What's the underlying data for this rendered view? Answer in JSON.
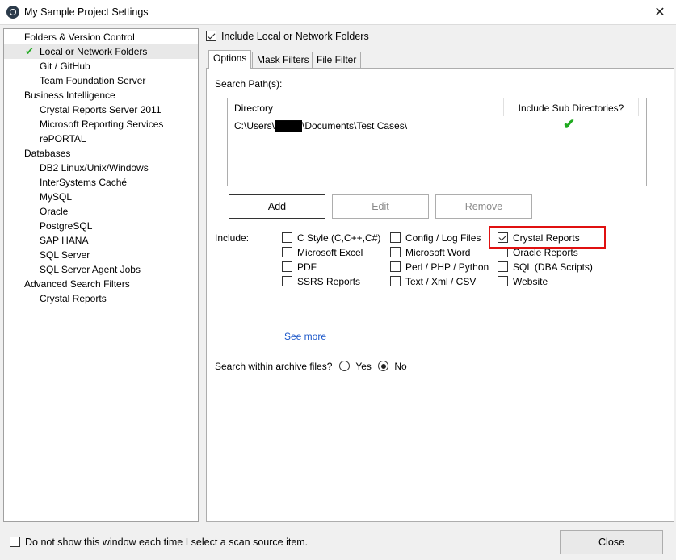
{
  "window": {
    "title": "My Sample Project Settings",
    "close_glyph": "✕"
  },
  "tree": [
    {
      "label": "Folders & Version Control",
      "indent": 0,
      "name": "tree-folders-version-control"
    },
    {
      "label": "Local or Network Folders",
      "indent": 1,
      "selected": true,
      "name": "tree-local-network-folders"
    },
    {
      "label": "Git / GitHub",
      "indent": 1,
      "name": "tree-git-github"
    },
    {
      "label": "Team Foundation Server",
      "indent": 1,
      "name": "tree-team-foundation-server"
    },
    {
      "label": "Business Intelligence",
      "indent": 0,
      "name": "tree-business-intelligence"
    },
    {
      "label": "Crystal Reports Server 2011",
      "indent": 1,
      "name": "tree-crystal-reports-server"
    },
    {
      "label": "Microsoft Reporting Services",
      "indent": 1,
      "name": "tree-ms-reporting-services"
    },
    {
      "label": "rePORTAL",
      "indent": 1,
      "name": "tree-reportal"
    },
    {
      "label": "Databases",
      "indent": 0,
      "name": "tree-databases"
    },
    {
      "label": "DB2 Linux/Unix/Windows",
      "indent": 1,
      "name": "tree-db2"
    },
    {
      "label": "InterSystems Caché",
      "indent": 1,
      "name": "tree-intersystems-cache"
    },
    {
      "label": "MySQL",
      "indent": 1,
      "name": "tree-mysql"
    },
    {
      "label": "Oracle",
      "indent": 1,
      "name": "tree-oracle"
    },
    {
      "label": "PostgreSQL",
      "indent": 1,
      "name": "tree-postgresql"
    },
    {
      "label": "SAP HANA",
      "indent": 1,
      "name": "tree-sap-hana"
    },
    {
      "label": "SQL Server",
      "indent": 1,
      "name": "tree-sql-server"
    },
    {
      "label": "SQL Server Agent Jobs",
      "indent": 1,
      "name": "tree-sql-server-agent-jobs"
    },
    {
      "label": "Advanced Search Filters",
      "indent": 0,
      "name": "tree-advanced-search-filters"
    },
    {
      "label": "Crystal Reports",
      "indent": 1,
      "name": "tree-crystal-reports"
    }
  ],
  "include_folders": {
    "label": "Include Local or Network Folders",
    "checked": true
  },
  "tabs": [
    "Options",
    "Mask Filters",
    "File Filter"
  ],
  "search_paths": {
    "label": "Search Path(s):",
    "col_directory": "Directory",
    "col_subdirs": "Include Sub Directories?",
    "rows": [
      {
        "path": "C:\\Users\\████\\Documents\\Test Cases\\",
        "subdirs": true
      }
    ],
    "check_glyph": "✔"
  },
  "buttons": {
    "add": "Add",
    "edit": "Edit",
    "remove": "Remove"
  },
  "include": {
    "label": "Include:",
    "items": [
      {
        "label": "C Style (C,C++,C#)",
        "checked": false,
        "name": "include-c-style"
      },
      {
        "label": "Microsoft Excel",
        "checked": false,
        "name": "include-ms-excel"
      },
      {
        "label": "PDF",
        "checked": false,
        "name": "include-pdf"
      },
      {
        "label": "SSRS Reports",
        "checked": false,
        "name": "include-ssrs"
      },
      {
        "label": "Config / Log Files",
        "checked": false,
        "name": "include-config-log"
      },
      {
        "label": "Microsoft Word",
        "checked": false,
        "name": "include-ms-word"
      },
      {
        "label": "Perl / PHP / Python",
        "checked": false,
        "name": "include-perl-php-python"
      },
      {
        "label": "Text / Xml / CSV",
        "checked": false,
        "name": "include-text-xml-csv"
      },
      {
        "label": "Crystal Reports",
        "checked": true,
        "name": "include-crystal-reports"
      },
      {
        "label": "Oracle Reports",
        "checked": false,
        "name": "include-oracle-reports"
      },
      {
        "label": "SQL (DBA Scripts)",
        "checked": false,
        "name": "include-sql-dba"
      },
      {
        "label": "Website",
        "checked": false,
        "name": "include-website"
      }
    ],
    "see_more": "See more"
  },
  "archive": {
    "label": "Search within archive files?",
    "yes": "Yes",
    "no": "No",
    "selected": "No"
  },
  "footer": {
    "dont_show_label": "Do not show this window each time I select a scan source item.",
    "dont_show_checked": false,
    "close_label": "Close"
  }
}
